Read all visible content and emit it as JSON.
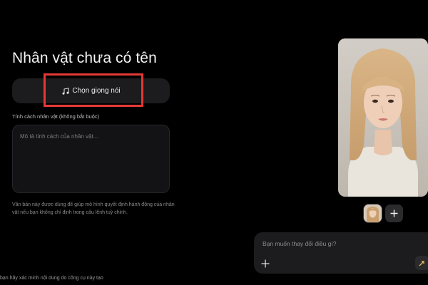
{
  "character": {
    "title": "Nhân vật chưa có tên"
  },
  "voice": {
    "button_label": "Chọn giọng nói",
    "icon": "music-note-icon",
    "highlight_color": "#e53935"
  },
  "personality": {
    "label": "Tính cách nhân vật (không bắt buộc)",
    "placeholder": "Mô tả tính cách của nhân vật...",
    "help_text": "Văn bản này được dùng để giúp mô hình quyết định hành động của nhân vật nếu bạn không chỉ định trong câu lệnh tuỳ chỉnh."
  },
  "preview": {
    "image": "character-portrait",
    "thumbnail": "portrait-thumbnail",
    "add_icon": "plus-icon"
  },
  "edit": {
    "placeholder": "Bạn muốn thay đổi điều gì?",
    "add_icon": "plus-icon",
    "send_icon": "send-icon"
  },
  "footer": {
    "note": "bạn hãy xác minh nội dung do công cụ này tạo"
  }
}
